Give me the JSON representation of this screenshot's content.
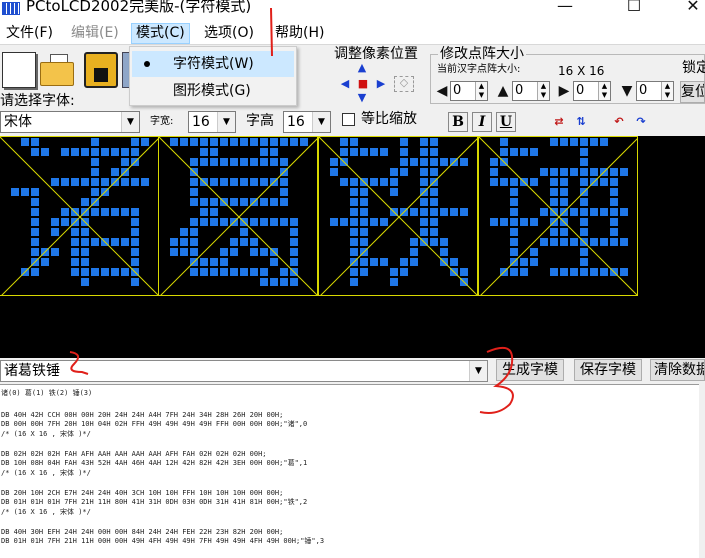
{
  "window": {
    "title": "PCtoLCD2002完美版-(字符模式)",
    "minimize": "—",
    "maximize": "☐",
    "close": "✕"
  },
  "menu": {
    "items": [
      "文件(F)",
      "编辑(E)",
      "模式(C)",
      "选项(O)",
      "帮助(H)"
    ],
    "active_index": 2,
    "dropdown": [
      "字符模式(W)",
      "图形模式(G)"
    ],
    "dropdown_checked_index": 0
  },
  "toolbar": {
    "pixel_adjust_title": "调整像素位置",
    "lattice_title": "修改点阵大小",
    "lattice_hint": "当前汉字点阵大小:",
    "lattice_size": "16 X 16",
    "spin_values": [
      "0",
      "0",
      "0",
      "0"
    ],
    "lock_button": "锁定",
    "reset_button": "复位",
    "font_prompt": "请选择字体:",
    "font_value": "宋体",
    "width_label": "字宽:",
    "width_value": "16",
    "height_label": "字高",
    "height_value": "16",
    "proportional_label": "等比缩放",
    "bold": "B",
    "italic": "I",
    "underline": "U"
  },
  "input": {
    "text": "诸葛铁锤",
    "generate_button": "生成字模",
    "save_button": "保存字模",
    "clear_button": "清除数据"
  },
  "output": {
    "header": "诸(0) 葛(1) 铁(2) 锤(3)",
    "blocks": [
      {
        "line1": "DB 40H 42H CCH 00H 00H 20H 24H 24H A4H 7FH 24H 34H 28H 26H 20H 00H;",
        "line2": "DB 00H 00H 7FH 20H 10H 04H 02H FFH 49H 49H 49H 49H FFH 00H 00H 00H;\"诸\",0",
        "line3": "/* (16 X 16 , 宋体 )*/"
      },
      {
        "line1": "DB 02H 02H 02H FAH AFH AAH AAH AAH AAH AFH FAH 02H 02H 02H 00H;",
        "line2": "DB 10H 08H 04H FAH 43H 52H 4AH 46H 4AH 12H 42H 82H 42H 3EH 00H 00H;\"葛\",1",
        "line3": "/* (16 X 16 , 宋体 )*/"
      },
      {
        "line1": "DB 20H 10H 2CH E7H 24H 24H 40H 3CH 10H 10H FFH 10H 10H 10H 00H 00H;",
        "line2": "DB 01H 01H 01H 7FH 21H 11H 80H 41H 31H 0DH 03H 0DH 31H 41H 81H 00H;\"铁\",2",
        "line3": "/* (16 X 16 , 宋体 )*/"
      },
      {
        "line1": "DB 40H 30H EFH 24H 24H 00H 00H 84H 24H 24H FEH 22H 23H 82H 20H 00H;",
        "line2": "DB 01H 01H 7FH 21H 11H 00H 00H 49H 4FH 49H 49H 7FH 49H 49H 4FH 49H 00H;\"锤\",3",
        "line3": ""
      }
    ]
  },
  "preview": {
    "characters": [
      "诸",
      "葛",
      "铁",
      "锤"
    ],
    "dot_color": "#1f77e8",
    "grid_color": "#d8d800",
    "background": "#000000"
  }
}
